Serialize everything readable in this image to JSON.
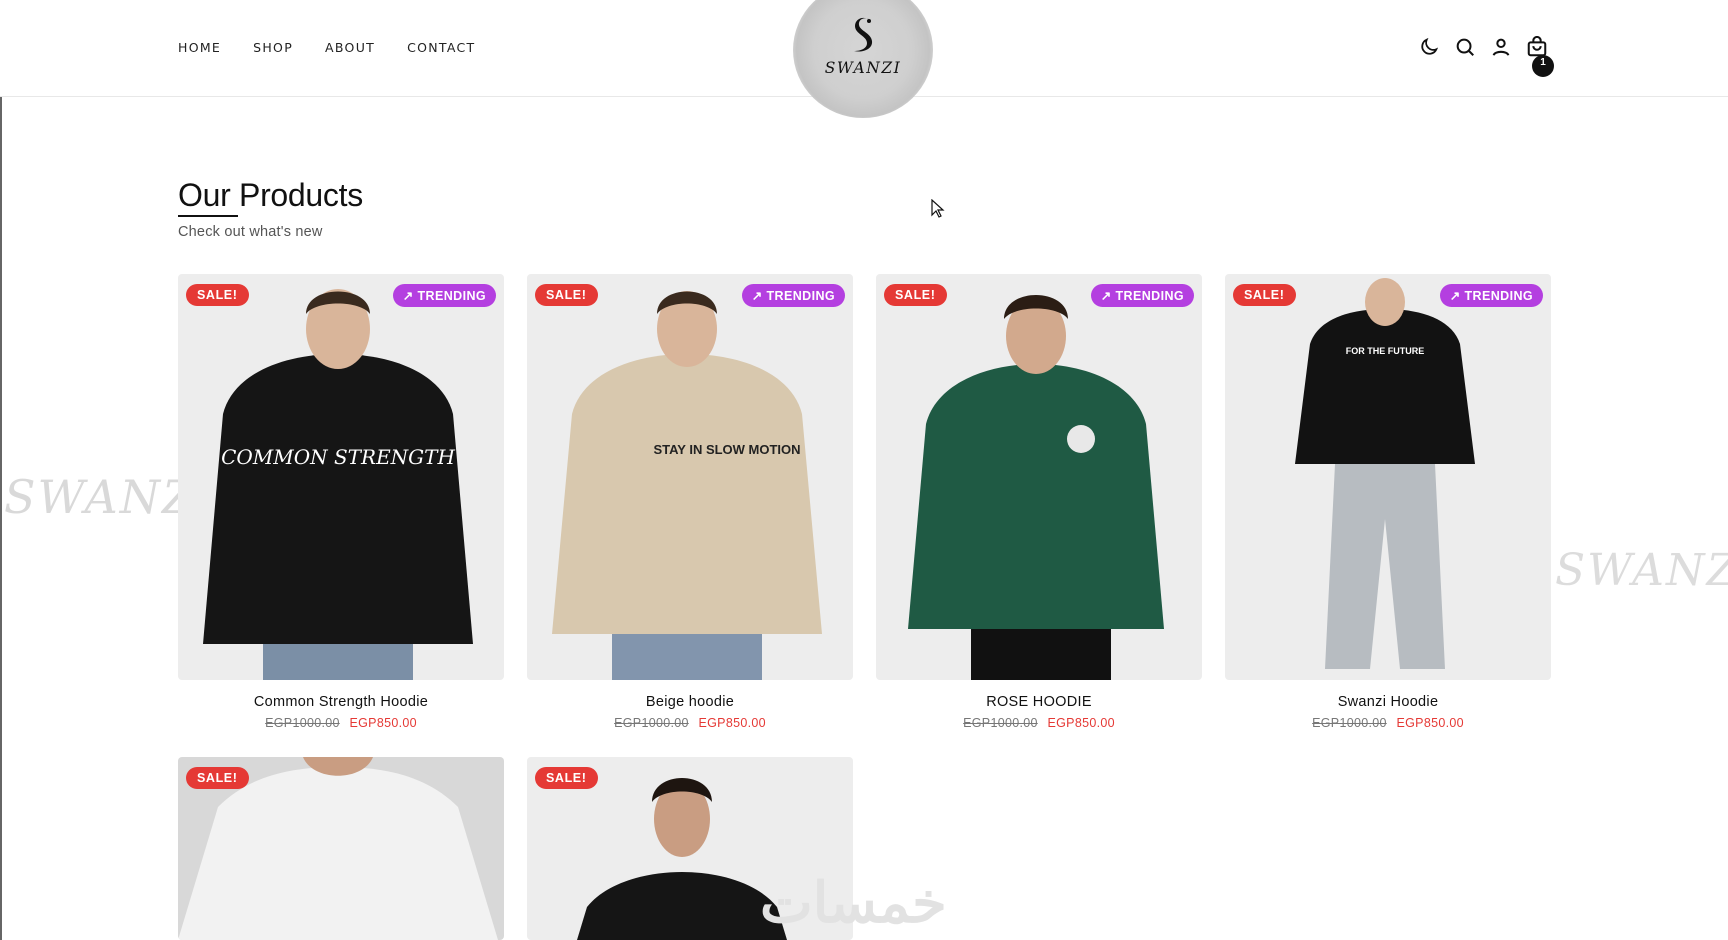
{
  "nav": {
    "links": [
      "HOME",
      "SHOP",
      "ABOUT",
      "CONTACT"
    ]
  },
  "brand": {
    "logo_text": "SWANZI"
  },
  "header_icons": {
    "theme": "moon-icon",
    "search": "search-icon",
    "account": "user-icon",
    "cart": "shopping-bag-icon",
    "cart_count": "1"
  },
  "section": {
    "title": "Our Products",
    "subtitle": "Check out what's new"
  },
  "background": {
    "watermark": "SWANZI",
    "overlay_text": "خمسات"
  },
  "products": [
    {
      "name": "Common Strength Hoodie",
      "old_price": "EGP1000.00",
      "price": "EGP850.00",
      "sale": "SALE!",
      "badge": "TRENDING",
      "color": "#151515",
      "print": "COMMON STRENGTH"
    },
    {
      "name": "Beige hoodie",
      "old_price": "EGP1000.00",
      "price": "EGP850.00",
      "sale": "SALE!",
      "badge": "TRENDING",
      "color": "#d8c8ae",
      "print": "STAY IN SLOW MOTION"
    },
    {
      "name": "ROSE HOODIE",
      "old_price": "EGP1000.00",
      "price": "EGP850.00",
      "sale": "SALE!",
      "badge": "TRENDING",
      "color": "#1f5a44",
      "print": ""
    },
    {
      "name": "Swanzi Hoodie",
      "old_price": "EGP1000.00",
      "price": "EGP850.00",
      "sale": "SALE!",
      "badge": "TRENDING",
      "color": "#121212",
      "print": "FOR THE FUTURE"
    },
    {
      "name": "",
      "old_price": "",
      "price": "",
      "sale": "SALE!",
      "badge": "",
      "color": "#f2f2f2",
      "print": ""
    },
    {
      "name": "",
      "old_price": "",
      "price": "",
      "sale": "SALE!",
      "badge": "",
      "color": "#151515",
      "print": ""
    }
  ],
  "colors": {
    "sale": "#e53935",
    "trending": "#b43fe0",
    "text": "#111111"
  }
}
